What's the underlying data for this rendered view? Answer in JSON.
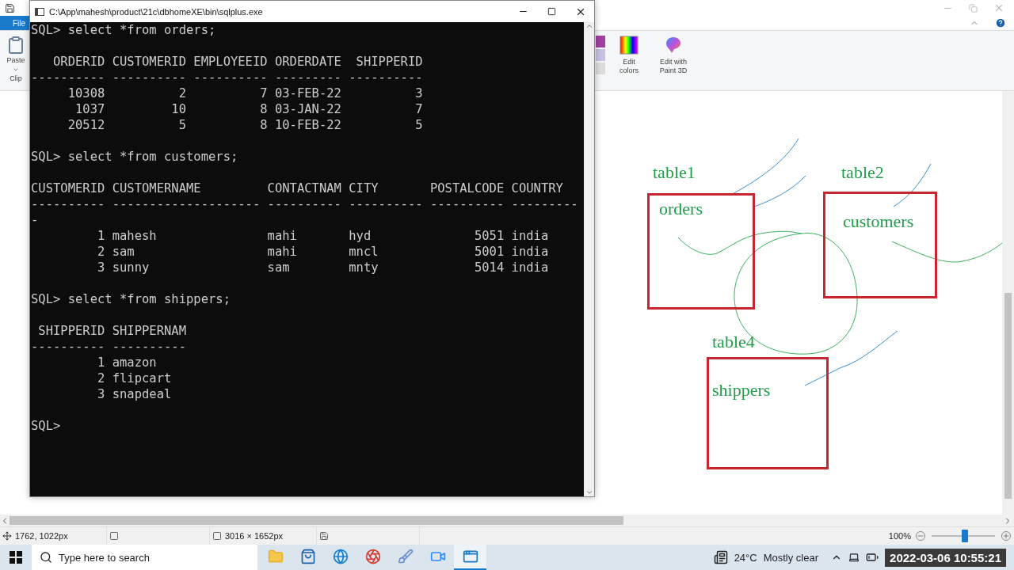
{
  "paint_window": {
    "file_tab": "File",
    "ribbon": {
      "paste": "Paste",
      "group_label": "Clip",
      "edit_colors": "Edit colors",
      "edit_paint3d": "Edit with Paint 3D"
    },
    "canvas": {
      "items": [
        {
          "title": "table1",
          "name": "orders"
        },
        {
          "title": "table2",
          "name": "customers"
        },
        {
          "title": "table4",
          "name": "shippers"
        }
      ]
    },
    "status_bar": {
      "cursor": "1762, 1022px",
      "size": "3016 × 1652px",
      "zoom": "100%",
      "zoom_slider": {
        "level": 0.5
      }
    }
  },
  "console_window": {
    "title": "C:\\App\\mahesh\\product\\21c\\dbhomeXE\\bin\\sqlplus.exe",
    "blocks": [
      [
        "SQL> select *from orders;"
      ],
      [
        "   ORDERID CUSTOMERID EMPLOYEEID ORDERDATE  SHIPPERID",
        "---------- ---------- ---------- --------- ----------",
        "     10308          2          7 03-FEB-22          3",
        "      1037         10          8 03-JAN-22          7",
        "     20512          5          8 10-FEB-22          5"
      ],
      [
        "SQL> select *from customers;"
      ],
      [
        "CUSTOMERID CUSTOMERNAME         CONTACTNAM CITY       POSTALCODE COUNTRY",
        "---------- -------------------- ---------- ---------- ---------- ---------",
        "-",
        "         1 mahesh               mahi       hyd              5051 india",
        "         2 sam                  mahi       mncl             5001 india",
        "         3 sunny                sam        mnty             5014 india"
      ],
      [
        "SQL> select *from shippers;"
      ],
      [
        " SHIPPERID SHIPPERNAM",
        "---------- ----------",
        "         1 amazon",
        "         2 flipcart",
        "         3 snapdeal"
      ],
      [
        "SQL>"
      ]
    ]
  },
  "taskbar": {
    "search": {
      "placeholder": "Type here to search"
    },
    "apps": [
      {
        "kind": "folder",
        "selected": false
      },
      {
        "kind": "store",
        "selected": false
      },
      {
        "kind": "edge",
        "selected": false
      },
      {
        "kind": "chrome",
        "selected": false
      },
      {
        "kind": "paint",
        "selected": false
      },
      {
        "kind": "zoom",
        "selected": false
      },
      {
        "kind": "window",
        "selected": true
      }
    ],
    "weather": {
      "temp": "24°C",
      "condition": "Mostly clear"
    },
    "timestamp": "2022-03-06 10:55:21"
  }
}
